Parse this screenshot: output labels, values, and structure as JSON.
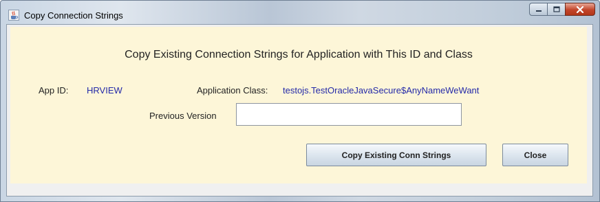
{
  "window": {
    "title": "Copy Connection Strings",
    "icon": "java-cup-icon",
    "caption_buttons": [
      "minimize-icon",
      "maximize-icon",
      "close-icon"
    ]
  },
  "dialog": {
    "heading": "Copy Existing Connection Strings for Application with This ID and Class",
    "app_id_label": "App ID:",
    "app_id_value": "HRVIEW",
    "app_class_label": "Application Class:",
    "app_class_value": "testojs.TestOracleJavaSecure$AnyNameWeWant",
    "previous_version_label": "Previous Version",
    "previous_version_value": "",
    "copy_button_label": "Copy Existing Conn Strings",
    "close_button_label": "Close"
  },
  "colors": {
    "panel_background": "#fdf6d8",
    "value_text": "#2329a8"
  }
}
